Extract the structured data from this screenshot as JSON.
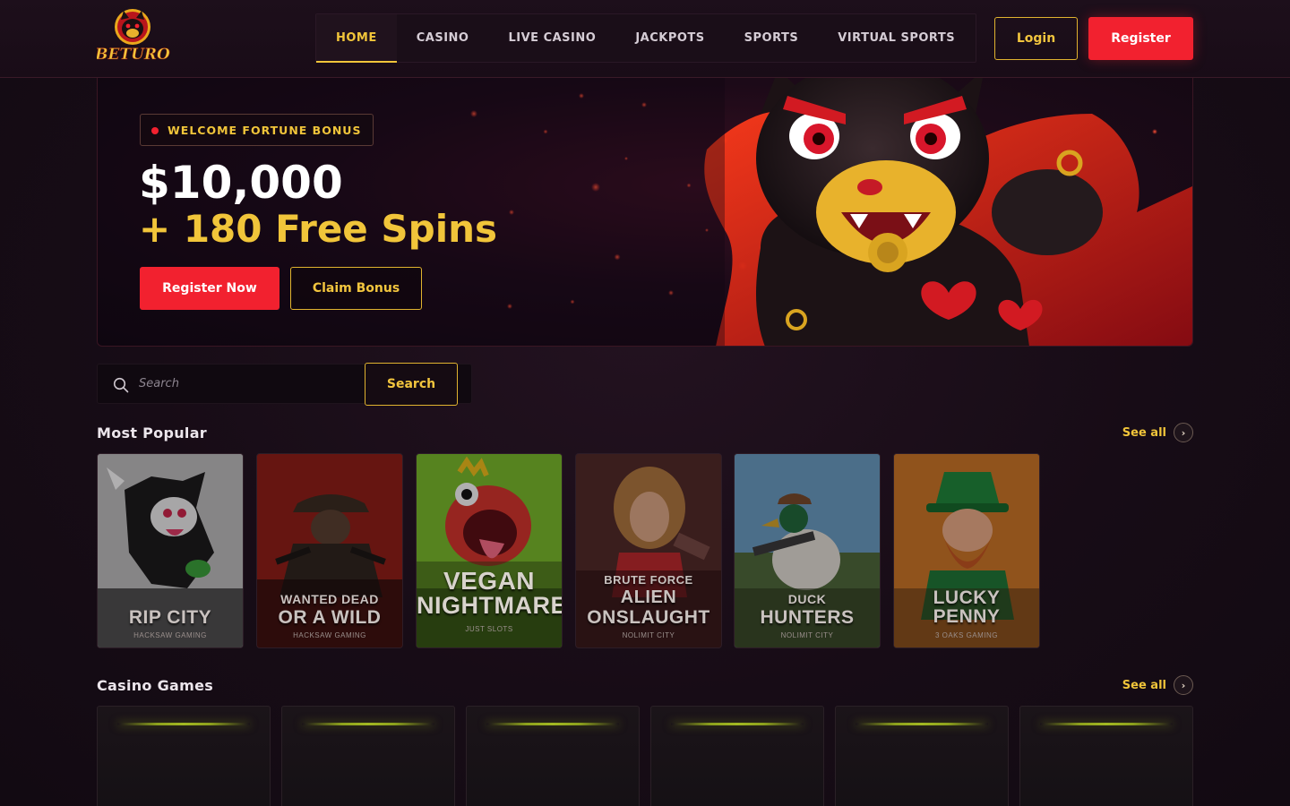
{
  "brand": {
    "logo_text": "BETURO"
  },
  "nav": {
    "items": [
      {
        "label": "HOME",
        "active": true
      },
      {
        "label": "CASINO",
        "active": false
      },
      {
        "label": "LIVE CASINO",
        "active": false
      },
      {
        "label": "JACKPOTS",
        "active": false
      },
      {
        "label": "SPORTS",
        "active": false
      },
      {
        "label": "VIRTUAL SPORTS",
        "active": false
      }
    ]
  },
  "auth": {
    "login_label": "Login",
    "register_label": "Register"
  },
  "hero": {
    "badge": "WELCOME FORTUNE BONUS",
    "amount": "$10,000",
    "spins": "+ 180 Free Spins",
    "register_now_label": "Register Now",
    "claim_bonus_label": "Claim Bonus"
  },
  "search": {
    "placeholder": "Search",
    "button_label": "Search"
  },
  "most_popular": {
    "title": "Most Popular",
    "see_all": "See all",
    "games": [
      {
        "title_line1": "",
        "title_line2": "RIP CITY",
        "provider": "HACKSAW GAMING"
      },
      {
        "title_line1": "WANTED DEAD",
        "title_line2": "OR A WILD",
        "provider": "HACKSAW GAMING"
      },
      {
        "title_line1": "VEGAN",
        "title_line2": "NIGHTMARE",
        "provider": "JUST SLOTS"
      },
      {
        "title_line0": "BRUTE FORCE",
        "title_line1": "ALIEN",
        "title_line2": "ONSLAUGHT",
        "provider": "NOLIMIT CITY"
      },
      {
        "title_line1": "DUCK",
        "title_line2": "HUNTERS",
        "provider": "NOLIMIT CITY"
      },
      {
        "title_line1": "LUCKY",
        "title_line2": "PENNY",
        "provider": "3 OAKS GAMING"
      }
    ]
  },
  "casino_games": {
    "title": "Casino Games",
    "see_all": "See all"
  },
  "colors": {
    "accent_gold": "#f1c53a",
    "accent_red": "#f2212f",
    "background": "#170c16"
  }
}
